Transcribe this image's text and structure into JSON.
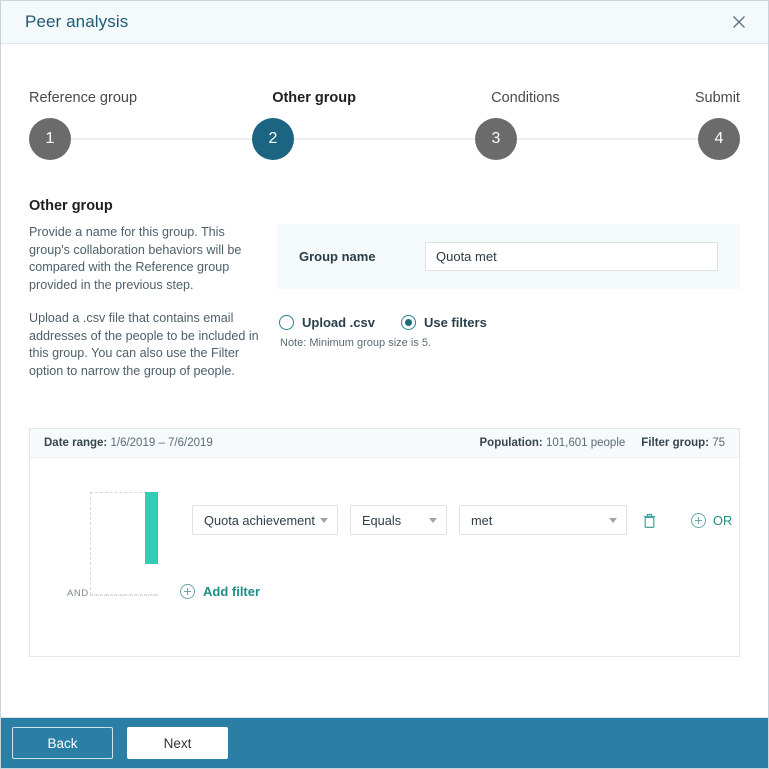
{
  "window": {
    "title": "Peer analysis",
    "close_icon": "close-icon"
  },
  "stepper": {
    "steps": [
      {
        "label": "Reference group",
        "number": "1",
        "active": false
      },
      {
        "label": "Other group",
        "number": "2",
        "active": true
      },
      {
        "label": "Conditions",
        "number": "3",
        "active": false
      },
      {
        "label": "Submit",
        "number": "4",
        "active": false
      }
    ]
  },
  "section": {
    "title": "Other group",
    "paragraph1": "Provide a name for this group. This group's collaboration behaviors will be compared with the Reference group provided in the previous step.",
    "paragraph2": "Upload a .csv file that contains email addresses of the people to be included in this group. You can also use the Filter option to narrow the group of people."
  },
  "form": {
    "group_name_label": "Group name",
    "group_name_value": "Quota met",
    "group_name_placeholder": "",
    "radio_upload_label": "Upload .csv",
    "radio_filters_label": "Use filters",
    "radio_selected": "Use filters",
    "note": "Note: Minimum group size is 5."
  },
  "filter_panel": {
    "date_range_label": "Date range:",
    "date_range_value": "1/6/2019 – 7/6/2019",
    "population_label": "Population:",
    "population_value": "101,601 people",
    "filter_group_label": "Filter group:",
    "filter_group_value": "75",
    "and_label": "AND",
    "rule": {
      "attribute": "Quota achievement",
      "operator": "Equals",
      "value": "met",
      "delete_icon": "trash-icon",
      "or_label": "OR",
      "or_icon": "plus-circle-icon"
    },
    "add_filter_label": "Add filter",
    "add_filter_icon": "plus-circle-icon"
  },
  "footer": {
    "back_label": "Back",
    "next_label": "Next"
  },
  "colors": {
    "accent_teal": "#31ccb2",
    "step_active": "#1b6482",
    "step_inactive": "#6b6b6b",
    "footer_blue": "#2b7fa4",
    "link_teal": "#1f8f86"
  }
}
